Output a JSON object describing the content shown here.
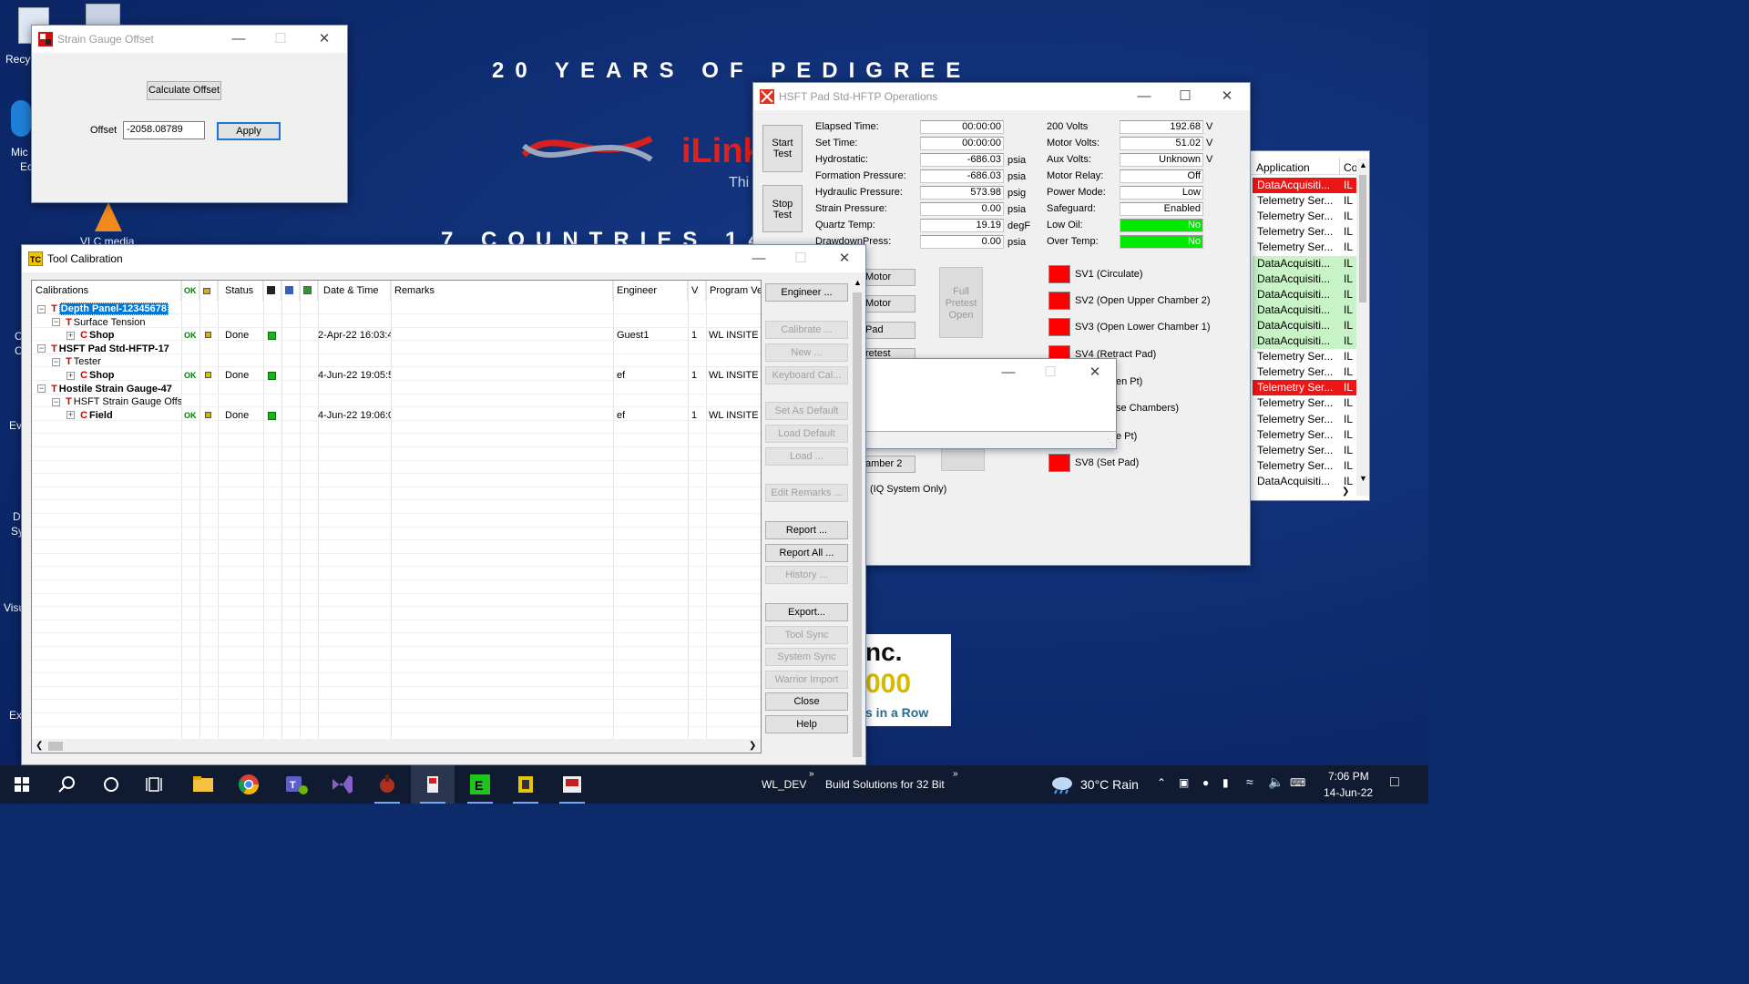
{
  "desktop": {
    "banner_top": "20 YEARS OF PEDIGREE",
    "banner_bottom": "7 COUNTRIES 14",
    "logo_text": "iLink",
    "logo_sub": "Thi",
    "inc_top": "nc.",
    "inc_mid": "000",
    "inc_bottom": "s in a Row",
    "icons": [
      "Recy",
      "Mic",
      "Ec",
      "VLC media",
      "Ev",
      "D",
      "Sy",
      "Visu",
      "Ex",
      "C",
      "C"
    ]
  },
  "strain_gauge": {
    "title": "Strain Gauge Offset",
    "calculate_label": "Calculate Offset",
    "offset_label": "Offset",
    "offset_value": "-2058.08789",
    "apply_label": "Apply"
  },
  "hsft": {
    "title": "HSFT Pad Std-HFTP Operations",
    "start_test": "Start\nTest",
    "stop_test": "Stop\nTest",
    "readings_left": [
      {
        "label": "Elapsed Time:",
        "value": "00:00:00",
        "unit": ""
      },
      {
        "label": "Set Time:",
        "value": "00:00:00",
        "unit": ""
      },
      {
        "label": "Hydrostatic:",
        "value": "-686.03",
        "unit": "psia"
      },
      {
        "label": "Formation Pressure:",
        "value": "-686.03",
        "unit": "psia"
      },
      {
        "label": "Hydraulic Pressure:",
        "value": "573.98",
        "unit": "psig"
      },
      {
        "label": "Strain Pressure:",
        "value": "0.00",
        "unit": "psia"
      },
      {
        "label": "Quartz Temp:",
        "value": "19.19",
        "unit": "degF"
      },
      {
        "label": "DrawdownPress:",
        "value": "0.00",
        "unit": "psia"
      }
    ],
    "readings_right": [
      {
        "label": "200 Volts",
        "value": "192.68",
        "unit": "V",
        "status": ""
      },
      {
        "label": "Motor Volts:",
        "value": "51.02",
        "unit": "V",
        "status": ""
      },
      {
        "label": "Aux Volts:",
        "value": "Unknown",
        "unit": "V",
        "status": ""
      },
      {
        "label": "Motor Relay:",
        "value": "Off",
        "unit": "",
        "status": ""
      },
      {
        "label": "Power Mode:",
        "value": "Low",
        "unit": "",
        "status": ""
      },
      {
        "label": "Safeguard:",
        "value": "Enabled",
        "unit": "",
        "status": ""
      },
      {
        "label": "Low Oil:",
        "value": "No",
        "unit": "",
        "status": "green"
      },
      {
        "label": "Over Temp:",
        "value": "No",
        "unit": "",
        "status": "green"
      }
    ],
    "motor_btn1": "Motor",
    "motor_btn2": "Motor",
    "pad_btn": "Pad",
    "pretest_btn": "retest",
    "chamber_btn": "amber 2",
    "full_pretest": "Full\nPretest\nOpen",
    "iq_label": "(IQ System Only)",
    "valves": [
      "SV1 (Circulate)",
      "SV2 (Open Upper Chamber 2)",
      "SV3 (Open Lower Chamber 1)",
      "SV4 (Retract Pad)",
      "en Pt)",
      "se Chambers)",
      "e Pt)",
      "SV8 (Set Pad)"
    ]
  },
  "applist": {
    "col1": "Application",
    "col2": "Co",
    "rows": [
      {
        "name": "DataAcquisiti...",
        "c2": "IL",
        "state": "red"
      },
      {
        "name": "Telemetry Ser...",
        "c2": "IL",
        "state": ""
      },
      {
        "name": "Telemetry Ser...",
        "c2": "IL",
        "state": ""
      },
      {
        "name": "Telemetry Ser...",
        "c2": "IL",
        "state": ""
      },
      {
        "name": "Telemetry Ser...",
        "c2": "IL",
        "state": ""
      },
      {
        "name": "DataAcquisiti...",
        "c2": "IL",
        "state": "green"
      },
      {
        "name": "DataAcquisiti...",
        "c2": "IL",
        "state": "green"
      },
      {
        "name": "DataAcquisiti...",
        "c2": "IL",
        "state": "green"
      },
      {
        "name": "DataAcquisiti...",
        "c2": "IL",
        "state": "green"
      },
      {
        "name": "DataAcquisiti...",
        "c2": "IL",
        "state": "green"
      },
      {
        "name": "DataAcquisiti...",
        "c2": "IL",
        "state": "green"
      },
      {
        "name": "Telemetry Ser...",
        "c2": "IL",
        "state": ""
      },
      {
        "name": "Telemetry Ser...",
        "c2": "IL",
        "state": ""
      },
      {
        "name": "Telemetry Ser...",
        "c2": "IL",
        "state": "red"
      },
      {
        "name": "Telemetry Ser...",
        "c2": "IL",
        "state": ""
      },
      {
        "name": "Telemetry Ser...",
        "c2": "IL",
        "state": ""
      },
      {
        "name": "Telemetry Ser...",
        "c2": "IL",
        "state": ""
      },
      {
        "name": "Telemetry Ser...",
        "c2": "IL",
        "state": ""
      },
      {
        "name": "Telemetry Ser...",
        "c2": "IL",
        "state": ""
      },
      {
        "name": "DataAcquisiti...",
        "c2": "IL",
        "state": ""
      }
    ]
  },
  "tool_cal": {
    "title": "Tool Calibration",
    "columns": {
      "calibrations": "Calibrations",
      "ok": "OK",
      "status": "Status",
      "datetime": "Date & Time",
      "remarks": "Remarks",
      "engineer": "Engineer",
      "v": "V",
      "program": "Program Ve"
    },
    "rows": [
      {
        "indent": 0,
        "type": "T",
        "name": "Depth Panel-12345678",
        "selected": true,
        "ok": "",
        "status": "",
        "date": "",
        "engineer": "",
        "v": "",
        "program": ""
      },
      {
        "indent": 1,
        "type": "T",
        "name": "Surface Tension",
        "selected": false,
        "ok": "",
        "status": "",
        "date": "",
        "engineer": "",
        "v": "",
        "program": ""
      },
      {
        "indent": 2,
        "type": "C",
        "name": "Shop",
        "selected": false,
        "ok": "OK",
        "status": "Done",
        "date": "2-Apr-22 16:03:4",
        "engineer": "Guest1",
        "v": "1",
        "program": "WL INSITE D"
      },
      {
        "indent": 0,
        "type": "T",
        "name": "HSFT Pad Std-HFTP-17",
        "selected": false,
        "ok": "",
        "status": "",
        "date": "",
        "engineer": "",
        "v": "",
        "program": ""
      },
      {
        "indent": 1,
        "type": "T",
        "name": "Tester",
        "selected": false,
        "ok": "",
        "status": "",
        "date": "",
        "engineer": "",
        "v": "",
        "program": ""
      },
      {
        "indent": 2,
        "type": "C",
        "name": "Shop",
        "selected": false,
        "ok": "OK",
        "status": "Done",
        "date": "4-Jun-22 19:05:5",
        "engineer": "ef",
        "v": "1",
        "program": "WL INSITE D"
      },
      {
        "indent": 0,
        "type": "T",
        "name": "Hostile Strain Gauge-47",
        "selected": false,
        "ok": "",
        "status": "",
        "date": "",
        "engineer": "",
        "v": "",
        "program": ""
      },
      {
        "indent": 1,
        "type": "T",
        "name": "HSFT Strain Gauge Offs",
        "selected": false,
        "ok": "",
        "status": "",
        "date": "",
        "engineer": "",
        "v": "",
        "program": ""
      },
      {
        "indent": 2,
        "type": "C",
        "name": "Field",
        "selected": false,
        "ok": "OK",
        "status": "Done",
        "date": "4-Jun-22 19:06:0",
        "engineer": "ef",
        "v": "1",
        "program": "WL INSITE D"
      }
    ],
    "buttons": [
      {
        "label": "Engineer ...",
        "enabled": true
      },
      {
        "label": "Calibrate ...",
        "enabled": false
      },
      {
        "label": "New ...",
        "enabled": false
      },
      {
        "label": "Keyboard Cal...",
        "enabled": false
      },
      {
        "label": "Set As Default",
        "enabled": false
      },
      {
        "label": "Load Default",
        "enabled": false
      },
      {
        "label": "Load ...",
        "enabled": false
      },
      {
        "label": "Edit Remarks ...",
        "enabled": false
      },
      {
        "label": "Report ...",
        "enabled": true
      },
      {
        "label": "Report All ...",
        "enabled": true
      },
      {
        "label": "History ...",
        "enabled": false
      },
      {
        "label": "Export...",
        "enabled": true
      },
      {
        "label": "Tool Sync",
        "enabled": false
      },
      {
        "label": "System Sync",
        "enabled": false
      },
      {
        "label": "Warrior Import",
        "enabled": false
      },
      {
        "label": "Close",
        "enabled": true
      },
      {
        "label": "Help",
        "enabled": true
      }
    ]
  },
  "taskbar": {
    "wl_dev": "WL_DEV",
    "build_label": "Build Solutions for 32 Bit",
    "weather": "30°C  Rain",
    "time": "7:06 PM",
    "date": "14-Jun-22"
  }
}
